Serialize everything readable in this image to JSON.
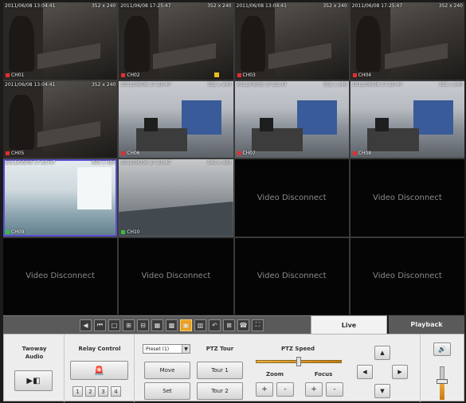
{
  "tiles": [
    {
      "kind": "room",
      "ts": "2011/06/08 13:04:41",
      "res": "352 x 240",
      "cam": "CH01",
      "rec": "red"
    },
    {
      "kind": "room",
      "ts": "2011/06/08 17:25:47",
      "res": "352 x 240",
      "cam": "CH02",
      "rec": "red"
    },
    {
      "kind": "room",
      "ts": "2011/06/08 13:04:41",
      "res": "352 x 240",
      "cam": "CH03",
      "rec": "red"
    },
    {
      "kind": "room",
      "ts": "2011/06/08 17:25:47",
      "res": "352 x 240",
      "cam": "CH04",
      "rec": "red"
    },
    {
      "kind": "room",
      "ts": "2011/06/08 13:04:41",
      "res": "352 x 240",
      "cam": "CH05",
      "rec": "red"
    },
    {
      "kind": "office",
      "ts": "2011/06/08 17:25:47",
      "res": "352 x 240",
      "cam": "CH06",
      "rec": "red"
    },
    {
      "kind": "office",
      "ts": "2011/06/08 17:25:47",
      "res": "352 x 240",
      "cam": "CH07",
      "rec": "red"
    },
    {
      "kind": "office",
      "ts": "2011/06/08 17:25:47",
      "res": "352 x 240",
      "cam": "CH08",
      "rec": "red"
    },
    {
      "kind": "bright",
      "ts": "2011/06/08 17:25:47",
      "res": "640 x 480",
      "cam": "CH09",
      "rec": "green"
    },
    {
      "kind": "hall",
      "ts": "2011/06/08 17:25:47",
      "res": "640 x 480",
      "cam": "CH10",
      "rec": "green"
    },
    {
      "kind": "disconnect",
      "text": "Video Disconnect"
    },
    {
      "kind": "disconnect",
      "text": "Video Disconnect"
    },
    {
      "kind": "disconnect",
      "text": "Video Disconnect"
    },
    {
      "kind": "disconnect",
      "text": "Video Disconnect"
    },
    {
      "kind": "disconnect",
      "text": "Video Disconnect"
    },
    {
      "kind": "disconnect",
      "text": "Video Disconnect"
    }
  ],
  "toolbar": {
    "buttons": [
      "◀",
      "⏮",
      "□",
      "⊞",
      "⊟",
      "▦",
      "▩",
      "▣",
      "▥",
      "↶",
      "⊠",
      "☎",
      "⛶"
    ],
    "active_index": 7
  },
  "tabs": {
    "live": "Live",
    "playback": "Playback"
  },
  "audio": {
    "label_line1": "Twoway",
    "label_line2": "Audio",
    "button_glyph": "▶◧"
  },
  "relay": {
    "label": "Relay Control",
    "alarm_glyph": "🚨",
    "channels": [
      "1",
      "2",
      "3",
      "4"
    ]
  },
  "preset": {
    "selected": "Preset (1)",
    "move": "Move",
    "set": "Set"
  },
  "ptz_tour": {
    "label": "PTZ Tour",
    "tour1": "Tour 1",
    "tour2": "Tour 2"
  },
  "ptz_speed": {
    "label": "PTZ Speed",
    "level": 0.5
  },
  "zoom": {
    "label": "Zoom",
    "plus": "+",
    "minus": "-"
  },
  "focus": {
    "label": "Focus",
    "plus": "+",
    "minus": "-"
  },
  "dpad": {
    "up": "▲",
    "down": "▼",
    "left": "◀",
    "right": "▶"
  },
  "volume": {
    "speaker_glyph": "🔊",
    "level": 0.55
  }
}
